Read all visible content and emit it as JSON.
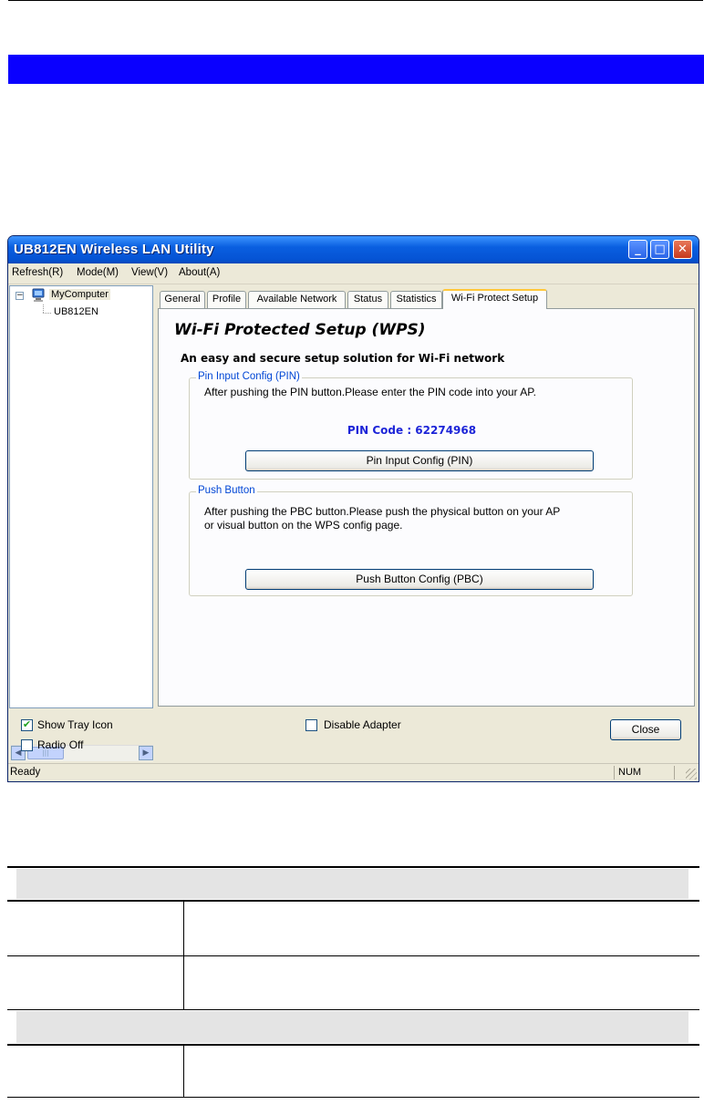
{
  "window": {
    "title": "UB812EN Wireless LAN Utility",
    "controls": {
      "minimize": "_",
      "maximize": "□",
      "close": "✕"
    }
  },
  "menu": [
    "Refresh(R)",
    "Mode(M)",
    "View(V)",
    "About(A)"
  ],
  "tree": {
    "root": "MyComputer",
    "child": "UB812EN",
    "expander": "−"
  },
  "tabs": [
    {
      "label": "General",
      "active": false
    },
    {
      "label": "Profile",
      "active": false
    },
    {
      "label": "Available Network",
      "active": false
    },
    {
      "label": "Status",
      "active": false
    },
    {
      "label": "Statistics",
      "active": false
    },
    {
      "label": "Wi-Fi Protect Setup",
      "active": true
    }
  ],
  "wps": {
    "title": "Wi-Fi Protected Setup (WPS)",
    "subtitle": "An easy and secure setup solution for Wi-Fi network",
    "pin_group": {
      "legend": "Pin Input Config (PIN)",
      "text": "After pushing the PIN button.Please enter the PIN code into your AP.",
      "pin_label": "PIN Code :  62274968",
      "button": "Pin Input Config (PIN)"
    },
    "pbc_group": {
      "legend": "Push Button",
      "text_line1": "After pushing the PBC button.Please push the physical button on your AP",
      "text_line2": "or visual button on the WPS config page.",
      "button": "Push Button Config (PBC)"
    }
  },
  "options": {
    "show_tray_icon": {
      "label": "Show Tray Icon",
      "checked": true
    },
    "radio_off": {
      "label": "Radio Off",
      "checked": false
    },
    "disable_adapter": {
      "label": "Disable Adapter",
      "checked": false
    },
    "close_button": "Close"
  },
  "statusbar": {
    "text": "Ready",
    "num": "NUM"
  },
  "colors": {
    "banner": "#0a00ff",
    "titlebar": "#0553d4",
    "legend": "#0046d5",
    "pin_code": "#1d25d8"
  }
}
